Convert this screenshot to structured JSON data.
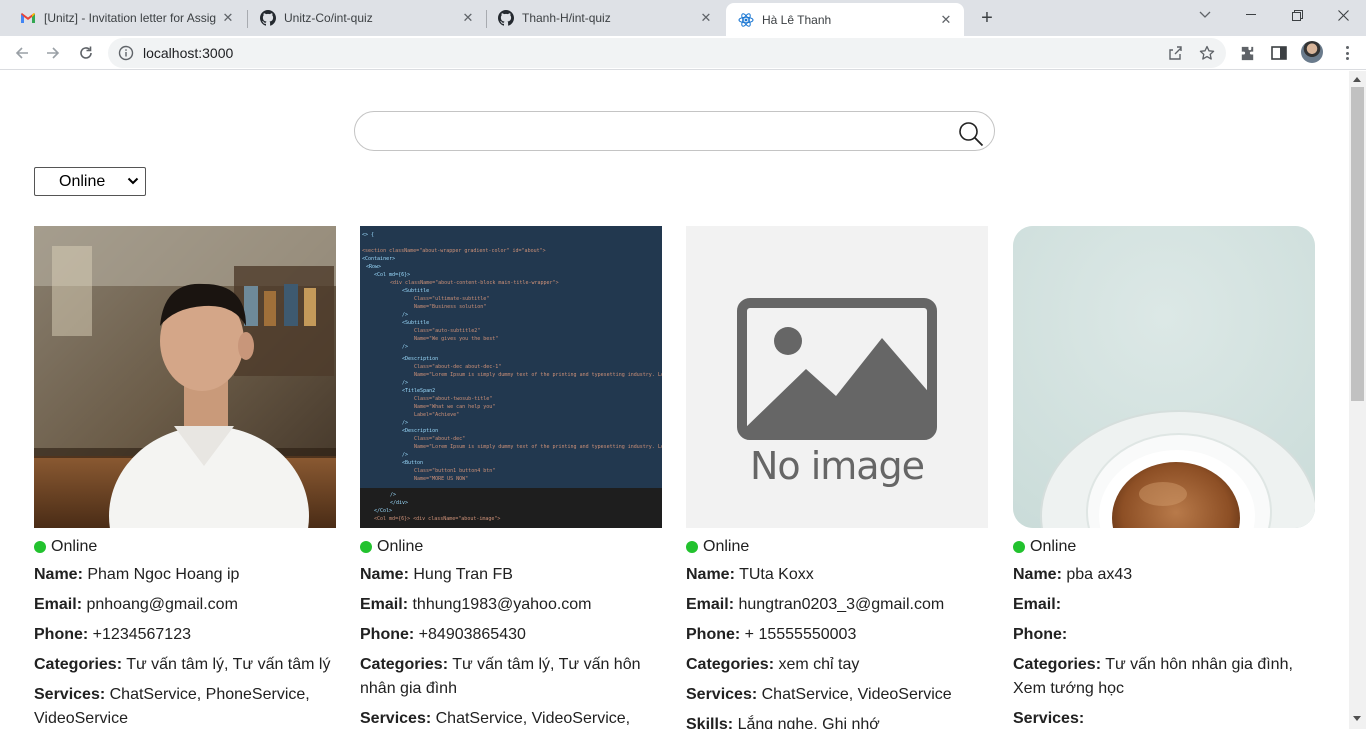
{
  "browser": {
    "tabs": [
      {
        "title": "[Unitz] - Invitation letter for Assig",
        "icon": "gmail-icon",
        "active": false
      },
      {
        "title": "Unitz-Co/int-quiz",
        "icon": "github-icon",
        "active": false
      },
      {
        "title": "Thanh-H/int-quiz",
        "icon": "github-icon",
        "active": false
      },
      {
        "title": "Hà Lê Thanh",
        "icon": "react-icon",
        "active": true
      }
    ],
    "url": "localhost:3000"
  },
  "page": {
    "search": {
      "value": "",
      "placeholder": ""
    },
    "status_filter": {
      "selected": "Online"
    },
    "no_image_text": "No image",
    "profiles": [
      {
        "status": "Online",
        "name_label": "Name:",
        "name": "Pham Ngoc Hoang ip",
        "email_label": "Email:",
        "email": "pnhoang@gmail.com",
        "phone_label": "Phone:",
        "phone": "+1234567123",
        "categories_label": "Categories:",
        "categories": "Tư vấn tâm lý, Tư vấn tâm lý",
        "services_label": "Services:",
        "services": "ChatService, PhoneService, VideoService",
        "photo": "man-portrait"
      },
      {
        "status": "Online",
        "name_label": "Name:",
        "name": "Hung Tran FB",
        "email_label": "Email:",
        "email": "thhung1983@yahoo.com",
        "phone_label": "Phone:",
        "phone": "+84903865430",
        "categories_label": "Categories:",
        "categories": "Tư vấn tâm lý, Tư vấn hôn nhân gia đình",
        "services_label": "Services:",
        "services": "ChatService, VideoService,",
        "photo": "code-screenshot"
      },
      {
        "status": "Online",
        "name_label": "Name:",
        "name": "TUta Koxx",
        "email_label": "Email:",
        "email": "hungtran0203_3@gmail.com",
        "phone_label": "Phone:",
        "phone": "+ 15555550003",
        "categories_label": "Categories:",
        "categories": "xem chỉ tay",
        "services_label": "Services:",
        "services": "ChatService, VideoService",
        "skills_label": "Skills:",
        "skills": "Lắng nghe, Ghi nhớ",
        "photo": "no-image-placeholder"
      },
      {
        "status": "Online",
        "name_label": "Name:",
        "name": "pba ax43",
        "email_label": "Email:",
        "email": "",
        "phone_label": "Phone:",
        "phone": "",
        "categories_label": "Categories:",
        "categories": "Tư vấn hôn nhân gia đình, Xem tướng học",
        "services_label": "Services:",
        "services": "",
        "photo": "coffee-cup"
      }
    ]
  },
  "colors": {
    "online_dot": "#22c22e",
    "tab_strip": "#dee1e6",
    "omnibox": "#f1f3f4"
  }
}
